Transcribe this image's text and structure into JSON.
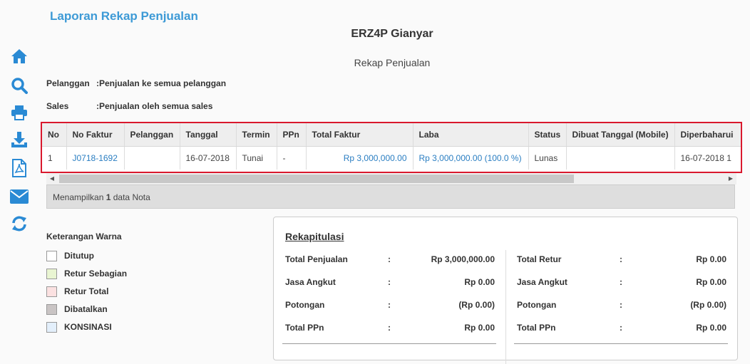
{
  "page_title": "Laporan Rekap Penjualan",
  "company": "ERZ4P Gianyar",
  "subtitle": "Rekap Penjualan",
  "info": {
    "pelanggan_label": "Pelanggan",
    "pelanggan_value": ":Penjualan ke semua pelanggan",
    "sales_label": "Sales",
    "sales_value": ":Penjualan oleh semua sales"
  },
  "sidebar": [
    "home-icon",
    "search-icon",
    "print-icon",
    "download-icon",
    "pdf-icon",
    "email-icon",
    "refresh-icon"
  ],
  "table": {
    "headers": [
      "No",
      "No Faktur",
      "Pelanggan",
      "Tanggal",
      "Termin",
      "PPn",
      "Total Faktur",
      "Laba",
      "Status",
      "Dibuat Tanggal (Mobile)",
      "Diperbaharui"
    ],
    "row": {
      "no": "1",
      "no_faktur": "J0718-1692",
      "pelanggan": "",
      "tanggal": "16-07-2018",
      "termin": "Tunai",
      "ppn": "-",
      "total_faktur": "Rp 3,000,000.00",
      "laba": "Rp 3,000,000.00 (100.0 %)",
      "status": "Lunas",
      "dibuat": "",
      "diperbaharui": "16-07-2018 1"
    }
  },
  "showing": {
    "prefix": "Menampilkan",
    "count": "1",
    "suffix": "data Nota"
  },
  "legend": {
    "title": "Keterangan Warna",
    "items": [
      {
        "label": "Ditutup",
        "color": "#ffffff"
      },
      {
        "label": "Retur Sebagian",
        "color": "#e9f5d2"
      },
      {
        "label": "Retur Total",
        "color": "#fbe1e1"
      },
      {
        "label": "Dibatalkan",
        "color": "#c9c4c4"
      },
      {
        "label": "KONSINASI",
        "color": "#e3effb"
      }
    ]
  },
  "rekap": {
    "title": "Rekapitulasi",
    "left": [
      {
        "label": "Total Penjualan",
        "sep": ":",
        "value": "Rp 3,000,000.00"
      },
      {
        "label": "Jasa Angkut",
        "sep": ":",
        "value": "Rp 0.00"
      },
      {
        "label": "Potongan",
        "sep": ":",
        "value": "(Rp 0.00)"
      },
      {
        "label": "Total PPn",
        "sep": ":",
        "value": "Rp 0.00"
      }
    ],
    "right": [
      {
        "label": "Total Retur",
        "sep": ":",
        "value": "Rp 0.00"
      },
      {
        "label": "Jasa Angkut",
        "sep": ":",
        "value": "Rp 0.00"
      },
      {
        "label": "Potongan",
        "sep": ":",
        "value": "(Rp 0.00)"
      },
      {
        "label": "Total PPn",
        "sep": ":",
        "value": "Rp 0.00"
      }
    ]
  },
  "colors": {
    "accent": "#3d9ad6",
    "link": "#2a7ec2",
    "highlight_border": "#d9182d"
  }
}
